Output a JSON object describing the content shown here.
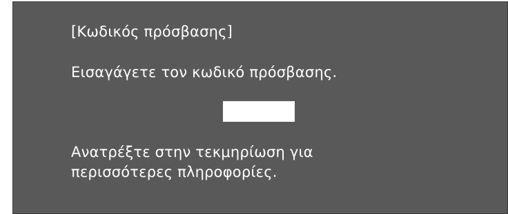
{
  "dialog": {
    "title": "[Κωδικός πρόσβασης]",
    "prompt": "Εισαγάγετε τον κωδικό πρόσβασης.",
    "password_value": "",
    "help_line_1": "Ανατρέξτε στην τεκμηρίωση για",
    "help_line_2": "περισσότερες πληροφορίες."
  },
  "colors": {
    "background": "#595959",
    "text": "#ffffff",
    "field": "#ffffff"
  }
}
